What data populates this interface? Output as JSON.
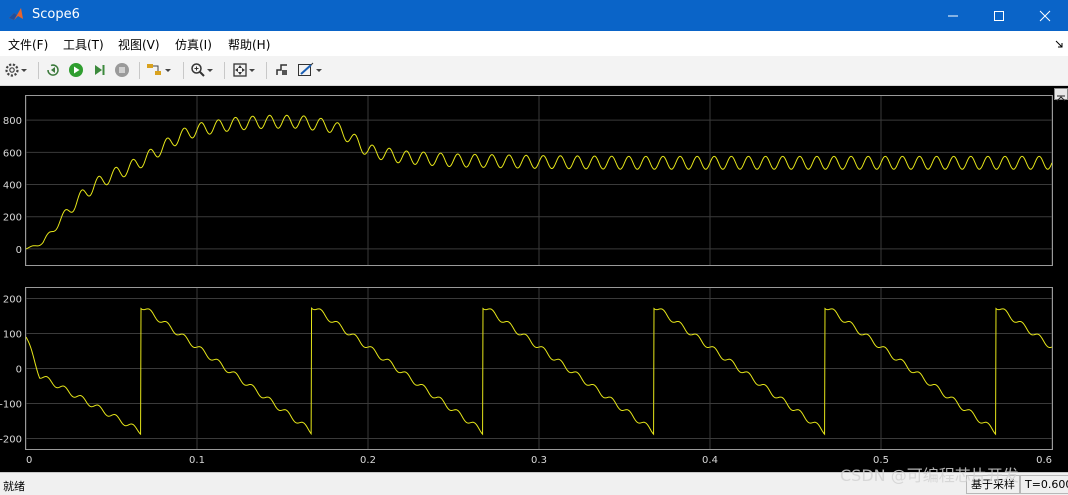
{
  "window": {
    "title": "Scope6",
    "icon": "matlab-icon"
  },
  "menu": [
    "文件(F)",
    "工具(T)",
    "视图(V)",
    "仿真(I)",
    "帮助(H)"
  ],
  "toolbar_icons": [
    "gear-icon",
    "step-back-icon",
    "run-icon",
    "step-forward-icon",
    "stop-icon",
    "highlight-icon",
    "zoom-icon",
    "autoscale-icon",
    "cursor-icon",
    "legend-icon"
  ],
  "plots": [
    {
      "yticks": [
        "800",
        "600",
        "400",
        "200",
        "0"
      ]
    },
    {
      "yticks": [
        "200",
        "100",
        "0",
        "-100",
        "-200"
      ]
    }
  ],
  "x_axis": {
    "ticks": [
      "0",
      "0.1",
      "0.2",
      "0.3",
      "0.4",
      "0.5",
      "0.6"
    ]
  },
  "chart_data": [
    {
      "type": "line",
      "series": [
        {
          "color": "#e6e619"
        }
      ],
      "xlim": [
        0,
        0.6
      ],
      "ylim": [
        -100,
        950
      ],
      "grid": true,
      "x": [
        0,
        0.01,
        0.02,
        0.03,
        0.04,
        0.05,
        0.06,
        0.07,
        0.08,
        0.09,
        0.1,
        0.12,
        0.14,
        0.16,
        0.18,
        0.19,
        0.2,
        0.22,
        0.25,
        0.3,
        0.35,
        0.4,
        0.45,
        0.5,
        0.55,
        0.6
      ],
      "y": [
        0,
        40,
        175,
        300,
        395,
        455,
        500,
        560,
        630,
        700,
        740,
        775,
        790,
        790,
        760,
        690,
        610,
        570,
        550,
        540,
        535,
        535,
        535,
        535,
        535,
        535
      ],
      "ripple_amplitude": 40,
      "ripple_period": 0.01
    },
    {
      "type": "line",
      "series": [
        {
          "color": "#e6e619"
        }
      ],
      "xlim": [
        0,
        0.6
      ],
      "ylim": [
        -230,
        230
      ],
      "grid": true,
      "waveform": "sawtooth",
      "period": 0.1,
      "first_reset": 0.067,
      "start_value": 90,
      "dip_value": -20,
      "high_value": 180,
      "low_value": -180,
      "ripple_amplitude": 8,
      "ripple_period": 0.01
    }
  ],
  "status": {
    "left": "就绪",
    "mode": "基于采样",
    "time": "T=0.600"
  },
  "watermark": "CSDN @可编程芯片开发"
}
